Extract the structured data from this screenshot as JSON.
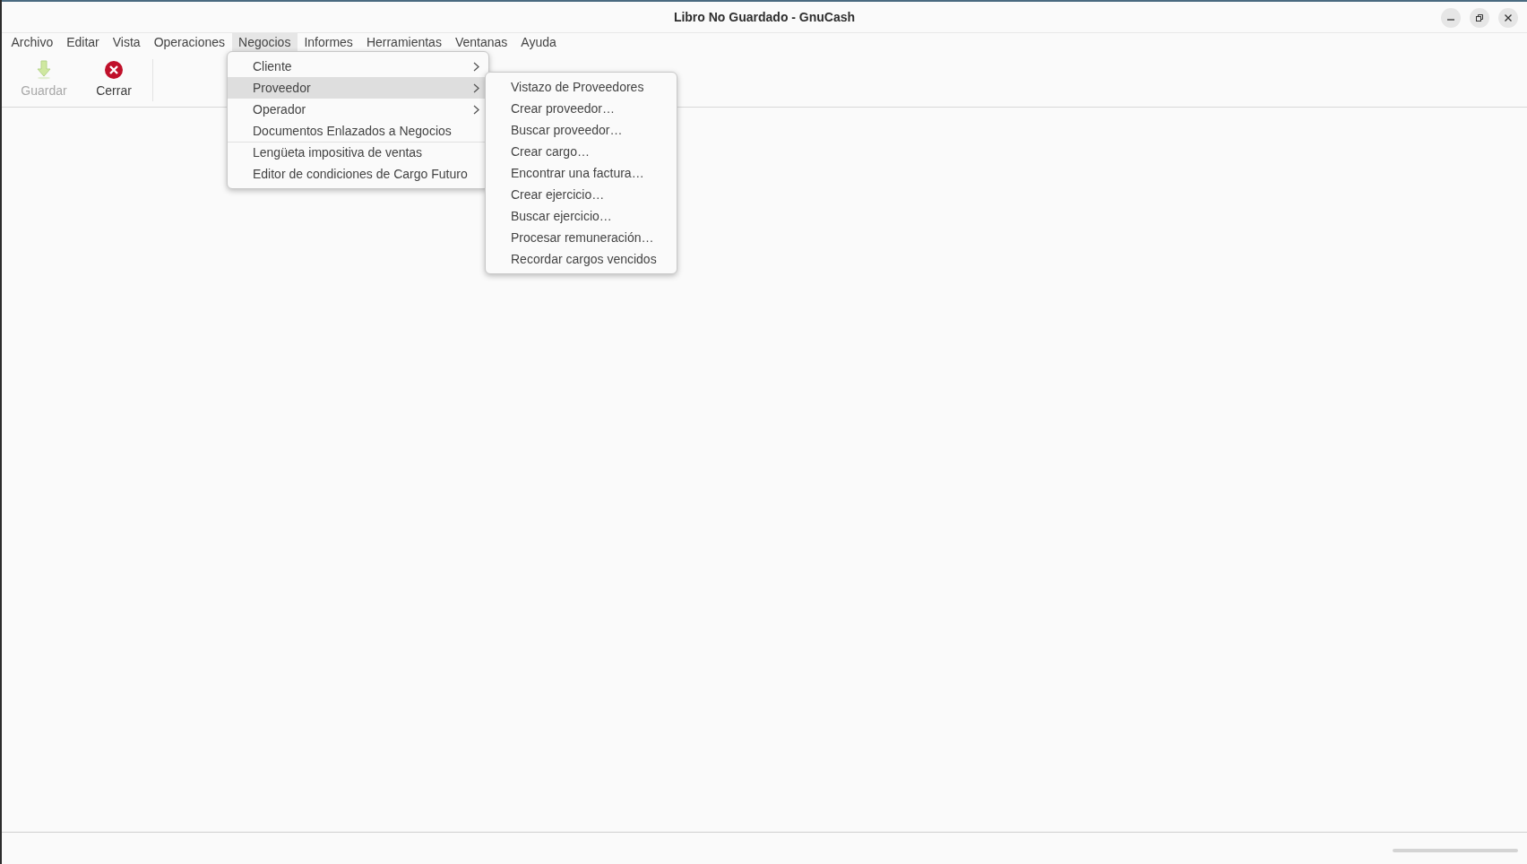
{
  "window": {
    "title": "Libro No Guardado - GnuCash"
  },
  "menubar": [
    {
      "label": "Archivo",
      "selected": false
    },
    {
      "label": "Editar",
      "selected": false
    },
    {
      "label": "Vista",
      "selected": false
    },
    {
      "label": "Operaciones",
      "selected": false
    },
    {
      "label": "Negocios",
      "selected": true
    },
    {
      "label": "Informes",
      "selected": false
    },
    {
      "label": "Herramientas",
      "selected": false
    },
    {
      "label": "Ventanas",
      "selected": false
    },
    {
      "label": "Ayuda",
      "selected": false
    }
  ],
  "toolbar": [
    {
      "label": "Guardar",
      "kind": "save",
      "disabled": true
    },
    {
      "label": "Cerrar",
      "kind": "close",
      "disabled": false
    }
  ],
  "menu": {
    "items": [
      {
        "label": "Cliente",
        "submenu": true,
        "selected": false,
        "separator_before": false
      },
      {
        "label": "Proveedor",
        "submenu": true,
        "selected": true,
        "separator_before": false
      },
      {
        "label": "Operador",
        "submenu": true,
        "selected": false,
        "separator_before": false
      },
      {
        "label": "Documentos Enlazados a Negocios",
        "submenu": false,
        "selected": false,
        "separator_before": false
      },
      {
        "label": "Lengüeta impositiva de ventas",
        "submenu": false,
        "selected": false,
        "separator_before": true
      },
      {
        "label": "Editor de condiciones de Cargo Futuro",
        "submenu": false,
        "selected": false,
        "separator_before": false
      }
    ]
  },
  "submenu": {
    "items": [
      "Vistazo de Proveedores",
      "Crear proveedor…",
      "Buscar proveedor…",
      "Crear cargo…",
      "Encontrar una factura…",
      "Crear ejercicio…",
      "Buscar ejercicio…",
      "Procesar remuneración…",
      "Recordar cargos vencidos"
    ]
  },
  "status_bar": {
    "progress": {
      "level": 0
    }
  }
}
